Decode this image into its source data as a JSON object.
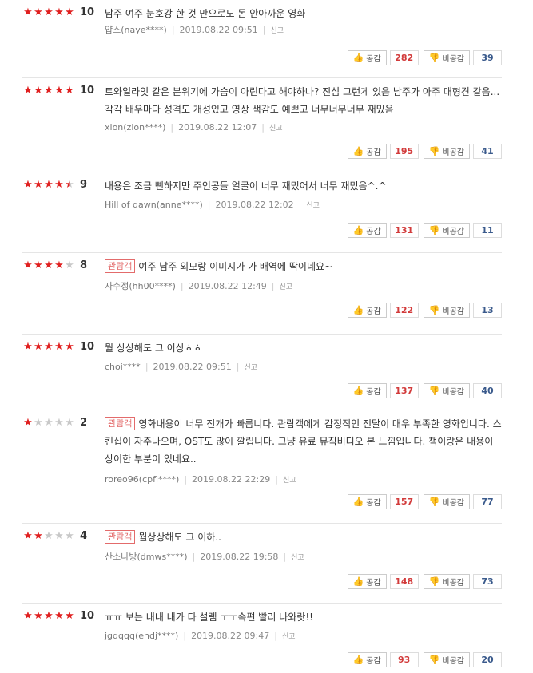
{
  "labels": {
    "like": "공감",
    "dislike": "비공감",
    "report": "신고",
    "audience_badge": "관람객"
  },
  "reviews": [
    {
      "stars": 5,
      "half": false,
      "score": "10",
      "badge": false,
      "text": "남주 여주 눈호강 한 것 만으로도 돈 안아까운 영화",
      "author": "얍스(naye****)",
      "date": "2019.08.22 09:51",
      "likes": "282",
      "dislikes": "39"
    },
    {
      "stars": 5,
      "half": false,
      "score": "10",
      "badge": false,
      "text": "트와일라잇 같은 분위기에 가슴이 아린다고 해야하나? 진심 그런게 있음 남주가 아주 대형견 같음... 각각 배우마다 성격도 개성있고 영상 색감도 예쁘고 너무너무너무 재밌음",
      "author": "xion(zion****)",
      "date": "2019.08.22 12:07",
      "likes": "195",
      "dislikes": "41"
    },
    {
      "stars": 4,
      "half": true,
      "score": "9",
      "badge": false,
      "text": "내용은 조금 뻔하지만 주인공들 얼굴이 너무 재밌어서 너무 재밌음^.^",
      "author": "Hill of dawn(anne****)",
      "date": "2019.08.22 12:02",
      "likes": "131",
      "dislikes": "11"
    },
    {
      "stars": 4,
      "half": false,
      "score": "8",
      "badge": true,
      "text": "여주 남주 외모랑 이미지가 가 배역에 딱이네요~",
      "author": "자수정(hh00****)",
      "date": "2019.08.22 12:49",
      "likes": "122",
      "dislikes": "13"
    },
    {
      "stars": 5,
      "half": false,
      "score": "10",
      "badge": false,
      "text": "뭘 상상해도 그 이상ㅎㅎ",
      "author": "choi****",
      "date": "2019.08.22 09:51",
      "likes": "137",
      "dislikes": "40"
    },
    {
      "stars": 1,
      "half": false,
      "score": "2",
      "badge": true,
      "text": "영화내용이 너무 전개가 빠릅니다. 관람객에게 감정적인 전달이 매우 부족한 영화입니다. 스킨십이 자주나오며, OST도 많이 깔립니다. 그냥 유료 뮤직비디오 본 느낌입니다. 책이랑은 내용이 상이한 부분이 있네요..",
      "author": "roreo96(cpfl****)",
      "date": "2019.08.22 22:29",
      "likes": "157",
      "dislikes": "77"
    },
    {
      "stars": 2,
      "half": false,
      "score": "4",
      "badge": true,
      "text": "뭘상상해도 그 이하..",
      "author": "산소나방(dmws****)",
      "date": "2019.08.22 19:58",
      "likes": "148",
      "dislikes": "73"
    },
    {
      "stars": 5,
      "half": false,
      "score": "10",
      "badge": false,
      "text": "ㅠㅠ 보는 내내 내가 다 설렘 ㅜㅜ속편 빨리 나와랏!!",
      "author": "jgqqqq(endj****)",
      "date": "2019.08.22 09:47",
      "likes": "93",
      "dislikes": "20"
    }
  ]
}
